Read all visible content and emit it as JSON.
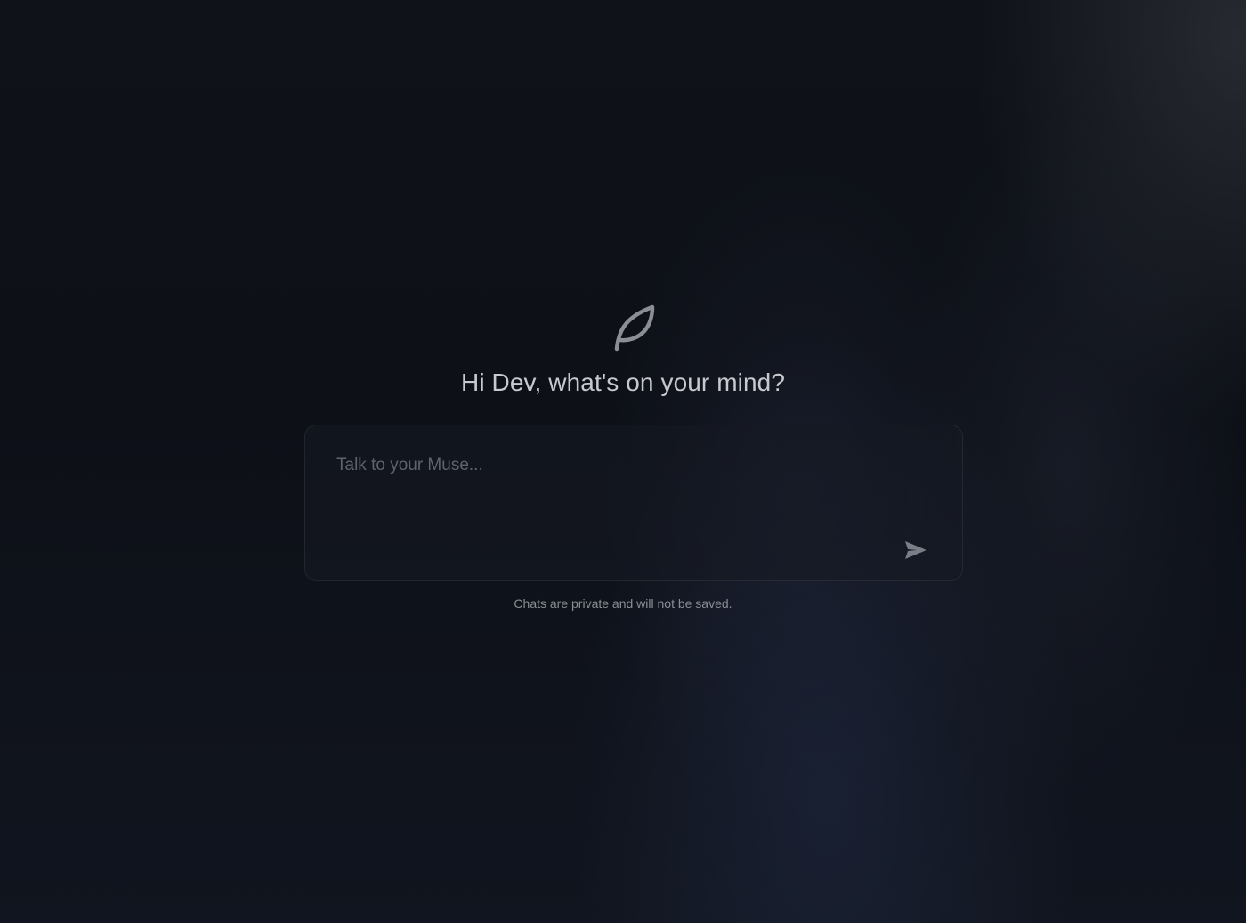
{
  "app": {
    "logo_icon": "leaf-icon"
  },
  "main": {
    "greeting": "Hi Dev, what's on your mind?",
    "chat": {
      "placeholder": "Talk to your Muse...",
      "value": "",
      "send_icon": "send-arrow-icon"
    },
    "privacy_note": "Chats are private and will not be saved."
  },
  "colors": {
    "background": "#0e1118",
    "text_primary": "#c7c9cf",
    "text_muted": "#8a8d94",
    "placeholder": "#5f636c",
    "icon": "#8b8e95"
  }
}
